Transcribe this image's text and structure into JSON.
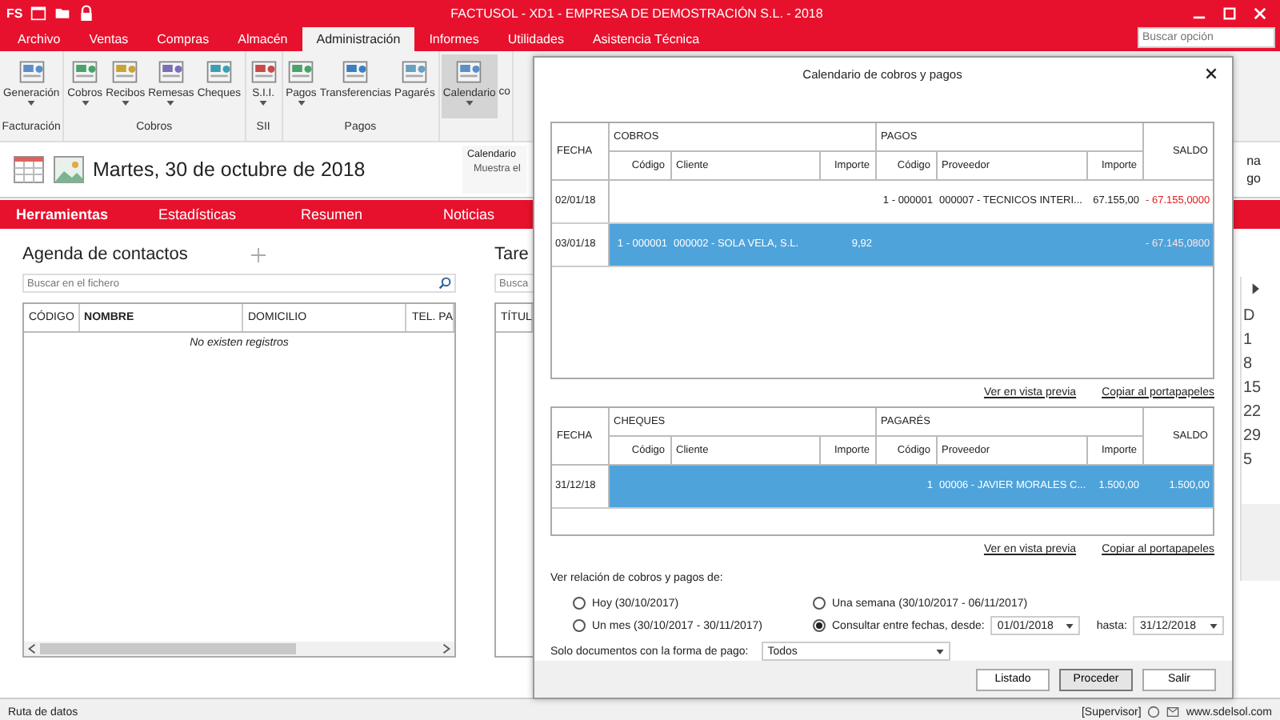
{
  "window": {
    "app_logo": "FS",
    "title": "FACTUSOL - XD1 - EMPRESA DE DEMOSTRACIÓN S.L. - 2018",
    "search_placeholder": "Buscar opción"
  },
  "menu_tabs": [
    {
      "label": "Archivo",
      "selected": false
    },
    {
      "label": "Ventas",
      "selected": false
    },
    {
      "label": "Compras",
      "selected": false
    },
    {
      "label": "Almacén",
      "selected": false
    },
    {
      "label": "Administración",
      "selected": true
    },
    {
      "label": "Informes",
      "selected": false
    },
    {
      "label": "Utilidades",
      "selected": false
    },
    {
      "label": "Asistencia Técnica",
      "selected": false
    }
  ],
  "ribbon_groups": [
    {
      "label": "Facturación",
      "buttons": [
        {
          "label": "Generación",
          "dropdown": true,
          "selected": false
        }
      ]
    },
    {
      "label": "Cobros",
      "buttons": [
        {
          "label": "Cobros",
          "dropdown": true,
          "selected": false
        },
        {
          "label": "Recibos",
          "dropdown": true,
          "selected": false
        },
        {
          "label": "Remesas",
          "dropdown": true,
          "selected": false
        },
        {
          "label": "Cheques",
          "dropdown": false,
          "selected": false
        }
      ]
    },
    {
      "label": "SII",
      "buttons": [
        {
          "label": "S.I.I.",
          "dropdown": true,
          "selected": false
        }
      ]
    },
    {
      "label": "Pagos",
      "buttons": [
        {
          "label": "Pagos",
          "dropdown": true,
          "selected": false
        },
        {
          "label": "Transferencias",
          "dropdown": false,
          "selected": false
        },
        {
          "label": "Pagarés",
          "dropdown": false,
          "selected": false
        }
      ]
    },
    {
      "buttons": [
        {
          "label": "Calendario",
          "dropdown": true,
          "selected": true
        }
      ]
    }
  ],
  "ribbon_overflow_text": "co",
  "header": {
    "date": "Martes, 30 de octubre de 2018",
    "calendar_title": "Calendario",
    "calendar_desc": "Muestra el",
    "side_texts": [
      "na",
      "go"
    ]
  },
  "nav_tabs": [
    {
      "label": "Herramientas",
      "selected": true
    },
    {
      "label": "Estadísticas",
      "selected": false
    },
    {
      "label": "Resumen",
      "selected": false
    },
    {
      "label": "Noticias",
      "selected": false
    }
  ],
  "contacts": {
    "title": "Agenda de contactos",
    "search_placeholder": "Buscar en el fichero",
    "columns": [
      {
        "label": "CÓDIGO",
        "sorted": false
      },
      {
        "label": "NOMBRE",
        "sorted": true
      },
      {
        "label": "DOMICILIO",
        "sorted": false
      },
      {
        "label": "TEL. PA",
        "sorted": false
      }
    ],
    "empty_text": "No existen registros"
  },
  "tasks": {
    "title": "Tare",
    "search_placeholder": "Busca",
    "columns": [
      "TÍTUL"
    ]
  },
  "mini_calendar": {
    "days": [
      "D",
      "1",
      "8",
      "15",
      "22",
      "29",
      "5"
    ]
  },
  "dialog": {
    "title": "Calendario de cobros y pagos",
    "tables": [
      {
        "date_header": "FECHA",
        "left_group": "COBROS",
        "right_group": "PAGOS",
        "balance_header": "SALDO",
        "sub_columns": [
          "Código",
          "Cliente",
          "Importe",
          "Código",
          "Proveedor",
          "Importe"
        ],
        "rows": [
          {
            "date": "02/01/18",
            "cells": [
              "",
              "",
              "",
              "1 - 000001",
              "000007 - TECNICOS INTERI...",
              "67.155,00"
            ],
            "balance": "- 67.155,0000",
            "negative": true,
            "selected": false
          },
          {
            "date": "03/01/18",
            "cells": [
              "1 - 000001",
              "000002 - SOLA VELA, S.L.",
              "9,92",
              "",
              "",
              ""
            ],
            "balance": "- 67.145,0800",
            "negative": true,
            "selected": true
          }
        ],
        "links": [
          "Ver en vista previa",
          "Copiar al portapapeles"
        ]
      },
      {
        "date_header": "FECHA",
        "left_group": "CHEQUES",
        "right_group": "PAGARÉS",
        "balance_header": "SALDO",
        "sub_columns": [
          "Código",
          "Cliente",
          "Importe",
          "Código",
          "Proveedor",
          "Importe"
        ],
        "rows": [
          {
            "date": "31/12/18",
            "cells": [
              "",
              "",
              "",
              "1",
              "00006 - JAVIER MORALES C...",
              "1.500,00"
            ],
            "balance": "1.500,00",
            "negative": false,
            "selected": true
          }
        ],
        "links": [
          "Ver en vista previa",
          "Copiar al portapapeles"
        ]
      }
    ],
    "period_label": "Ver relación de cobros y pagos de:",
    "period_options": [
      {
        "label": "Hoy (30/10/2017)",
        "kind": "preset",
        "selected": false
      },
      {
        "label": "Una semana (30/10/2017 - 06/11/2017)",
        "kind": "preset",
        "selected": false
      },
      {
        "label": "Un mes (30/10/2017 - 30/11/2017)",
        "kind": "preset",
        "selected": false
      },
      {
        "label": "Consultar entre fechas, desde:",
        "kind": "range",
        "selected": true
      }
    ],
    "date_from": "01/01/2018",
    "until_label": "hasta:",
    "date_to": "31/12/2018",
    "payment_label": "Solo documentos con la forma de pago:",
    "payment_value": "Todos",
    "buttons": [
      {
        "label": "Listado",
        "focused": false
      },
      {
        "label": "Proceder",
        "focused": true
      },
      {
        "label": "Salir",
        "focused": false
      }
    ]
  },
  "status_bar": {
    "path": "Ruta de datos",
    "user": "[Supervisor]",
    "site": "www.sdelsol.com"
  }
}
